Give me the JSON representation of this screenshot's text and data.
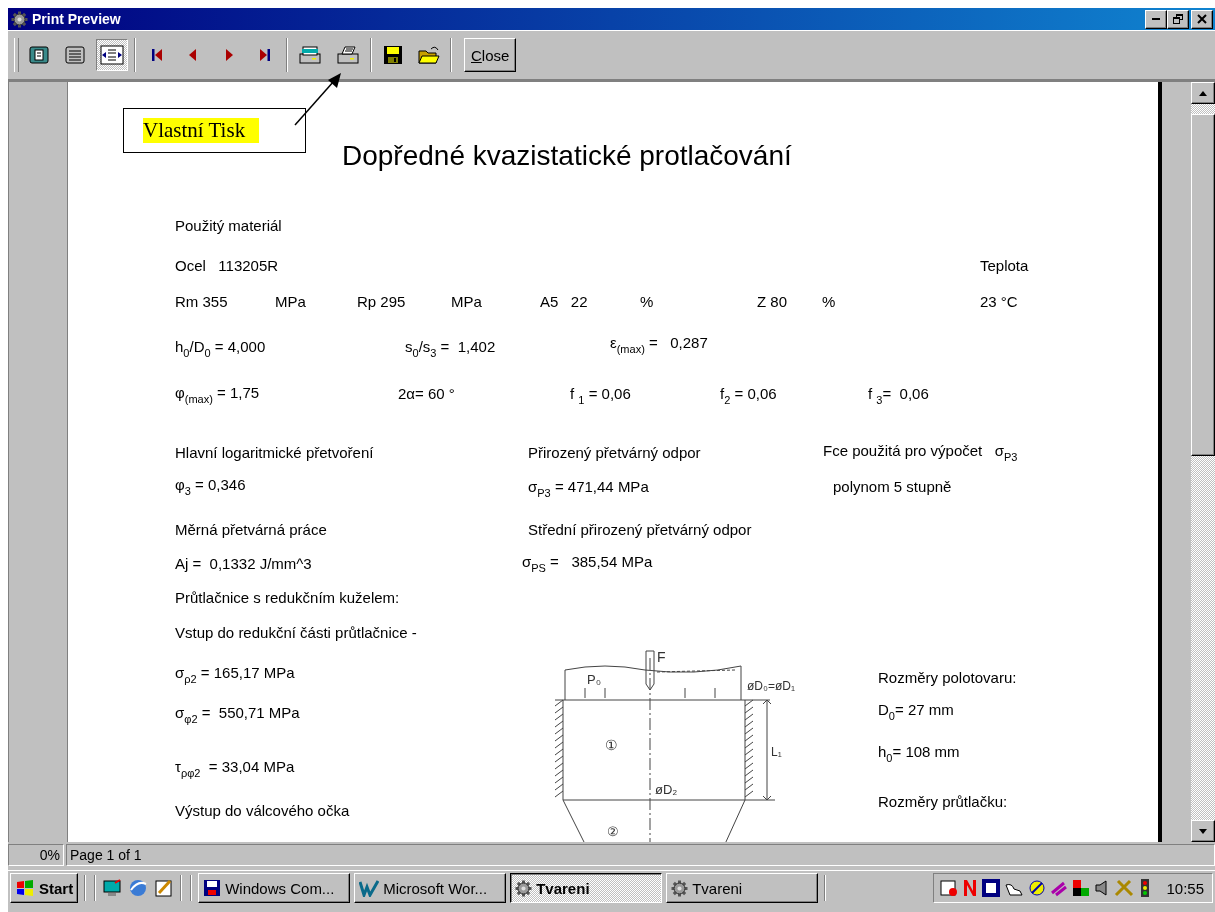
{
  "window": {
    "title": "Print Preview"
  },
  "toolbar": {
    "groups": [
      [
        {
          "kind": "one-page",
          "selected": false
        },
        {
          "kind": "multi-page",
          "selected": false
        },
        {
          "kind": "fit-width",
          "selected": true
        }
      ],
      [
        {
          "kind": "first"
        },
        {
          "kind": "prev"
        },
        {
          "kind": "next"
        },
        {
          "kind": "last"
        }
      ],
      [
        {
          "kind": "print-setup"
        },
        {
          "kind": "print"
        }
      ],
      [
        {
          "kind": "save"
        },
        {
          "kind": "open"
        }
      ]
    ],
    "close_button": {
      "label": "Close"
    }
  },
  "callout": {
    "text": "Vlastní Tisk"
  },
  "report": {
    "title": "Dopředné kvazistatické protlačování",
    "fields": [
      {
        "text": "Použitý materiál"
      },
      {
        "text": "Ocel   113205R"
      },
      {
        "text": "Teplota"
      },
      {
        "text": "Rm 355"
      },
      {
        "text": "MPa"
      },
      {
        "text": "Rp 295"
      },
      {
        "text": "MPa"
      },
      {
        "text": "A5   22"
      },
      {
        "text": "%"
      },
      {
        "text": "Z 80"
      },
      {
        "text": "%"
      },
      {
        "text": "23 °C"
      },
      {
        "text": "h$_{0}$/D$_{0}$ = 4,000"
      },
      {
        "text": "s$_{0}$/s$_{3}$ =  1,402"
      },
      {
        "text": "ε$_{(max)}$ =   0,287"
      },
      {
        "text": "φ$_{(max)}$ = 1,75"
      },
      {
        "text": "2α= 60 °"
      },
      {
        "text": "f $_{1}$ = 0,06"
      },
      {
        "text": "f$_{2}$ = 0,06"
      },
      {
        "text": "f $_{3}$=  0,06"
      },
      {
        "text": "Hlavní logaritmické přetvoření"
      },
      {
        "text": "Přirozený přetvárný odpor"
      },
      {
        "text": "Fce použitá pro výpočet   σ$_{P3}$"
      },
      {
        "text": "φ$_{3}$ = 0,346"
      },
      {
        "text": "σ$_{P3}$ = 471,44 MPa"
      },
      {
        "text": "polynom 5 stupně"
      },
      {
        "text": "Měrná přetvárná práce"
      },
      {
        "text": "Střední přirozený přetvárný odpor"
      },
      {
        "text": "Aj =  0,1332 J/mm^3"
      },
      {
        "text": "σ$_{PS}$ =   385,54 MPa"
      },
      {
        "text": "Průtlačnice s redukčním kuželem:"
      },
      {
        "text": "Vstup do redukční části průtlačnice -"
      },
      {
        "text": "σ$_{ρ2}$ = 165,17 MPa"
      },
      {
        "text": "σ$_{φ2}$ =  550,71 MPa"
      },
      {
        "text": "τ$_{ρφ2}$  = 33,04 MPa"
      },
      {
        "text": "Výstup do válcového očka"
      },
      {
        "text": "Rozměry polotovaru:"
      },
      {
        "text": "D$_{0}$= 27 mm"
      },
      {
        "text": "h$_{0}$= 108 mm"
      },
      {
        "text": "Rozměry průtlačku:"
      }
    ],
    "drawing_labels": [
      "F",
      "P₀",
      "øD₀=øD₁",
      "L₁",
      "øD₂",
      "①",
      "②"
    ]
  },
  "status_bar": {
    "zoom": "0%",
    "page": "Page 1 of 1"
  },
  "taskbar": {
    "start": "Start",
    "quick_launch": [
      {
        "kind": "desktop"
      },
      {
        "kind": "browser"
      },
      {
        "kind": "notepad"
      }
    ],
    "tasks": [
      {
        "label": "Windows Com...",
        "kind": "disk",
        "selected": false
      },
      {
        "label": "Microsoft Wor...",
        "kind": "word",
        "selected": false
      },
      {
        "label": "Tvareni",
        "kind": "gear",
        "selected": true
      },
      {
        "label": "Tvareni",
        "kind": "gear",
        "selected": false
      }
    ],
    "clock": "10:55"
  }
}
